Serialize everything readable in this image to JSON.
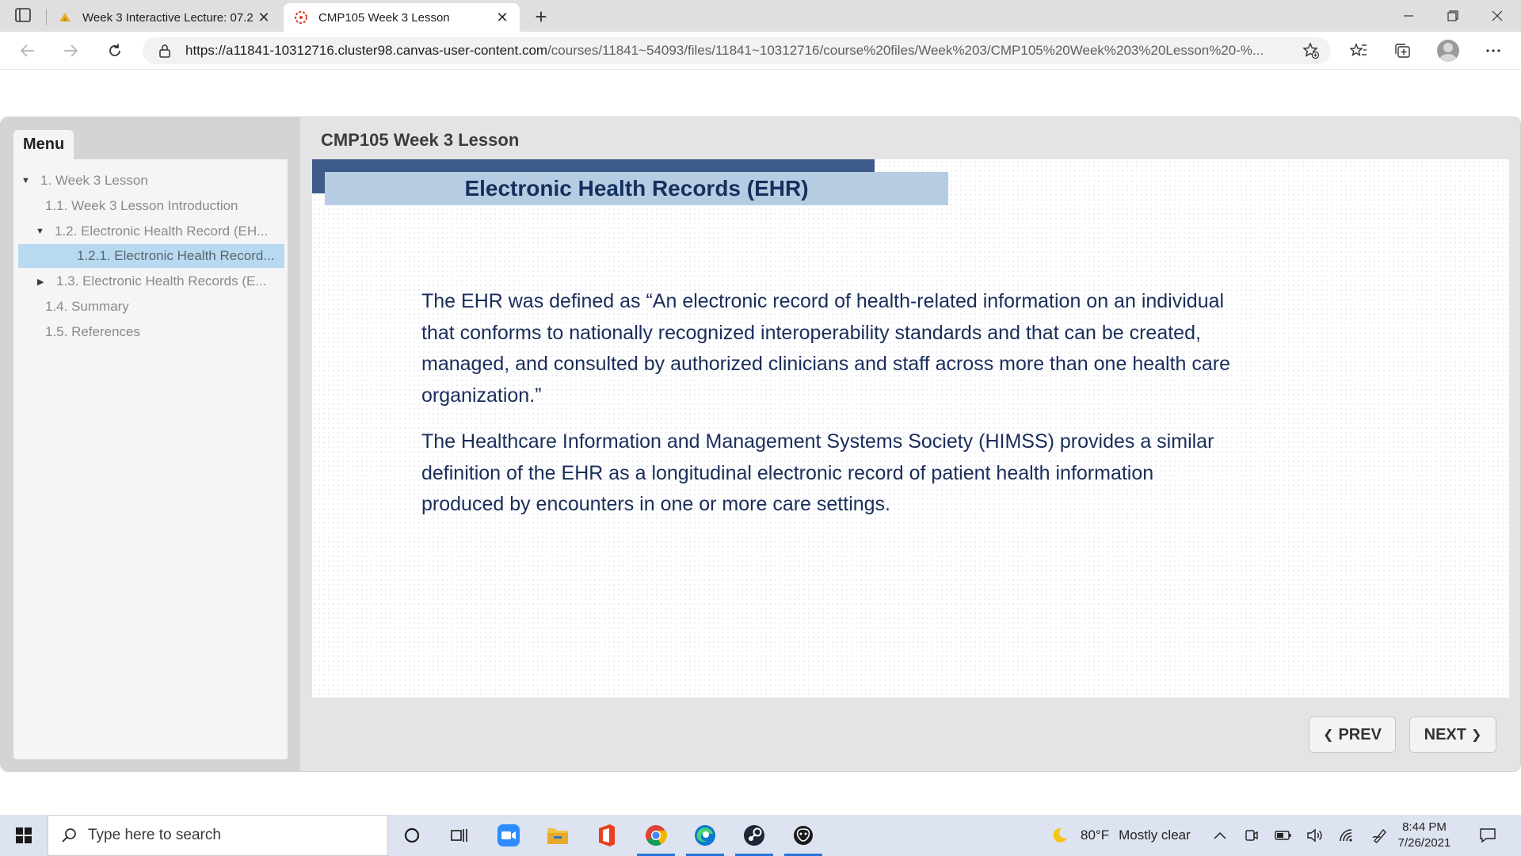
{
  "browser": {
    "tabs": [
      {
        "title": "Week 3 Interactive Lecture: 07.2",
        "active": false
      },
      {
        "title": "CMP105 Week 3 Lesson",
        "active": true
      }
    ],
    "url_host": "https://a11841-10312716.cluster98.canvas-user-content.com",
    "url_path": "/courses/11841~54093/files/11841~10312716/course%20files/Week%203/CMP105%20Week%203%20Lesson%20-%..."
  },
  "player": {
    "menu_label": "Menu",
    "title": "CMP105 Week 3 Lesson",
    "menu_items": [
      {
        "label": "1. Week 3 Lesson",
        "level": 0,
        "caret": "down"
      },
      {
        "label": "1.1. Week 3 Lesson Introduction",
        "level": 1,
        "caret": ""
      },
      {
        "label": "1.2. Electronic Health Record (EH...",
        "level": 1,
        "caret": "down"
      },
      {
        "label": "1.2.1. Electronic Health Record...",
        "level": 2,
        "caret": "",
        "selected": true
      },
      {
        "label": "1.3. Electronic Health Records (E...",
        "level": 1,
        "caret": "right"
      },
      {
        "label": "1.4. Summary",
        "level": 1,
        "caret": ""
      },
      {
        "label": "1.5. References",
        "level": 1,
        "caret": ""
      }
    ],
    "slide": {
      "heading": "Electronic Health Records (EHR)",
      "paragraphs": [
        "The EHR was defined as “An electronic record of health-related information on an individual that conforms to nationally recognized interoperability standards and that can be created, managed, and consulted by authorized clinicians and staff across more than one health care organization.”",
        "The Healthcare Information and Management Systems Society (HIMSS) provides a similar definition of the EHR as a longitudinal electronic record of patient health information produced by encounters in one or more care settings."
      ]
    },
    "prev_label": "PREV",
    "next_label": "NEXT"
  },
  "taskbar": {
    "search_placeholder": "Type here to search",
    "weather_temp": "80°F",
    "weather_text": "Mostly clear",
    "time": "8:44 PM",
    "date": "7/26/2021"
  },
  "colors": {
    "banner_dark": "#3e5a8a",
    "banner_light": "#b6cce3",
    "slide_text": "#1a2d5a",
    "selected_item": "#b8daf0"
  }
}
